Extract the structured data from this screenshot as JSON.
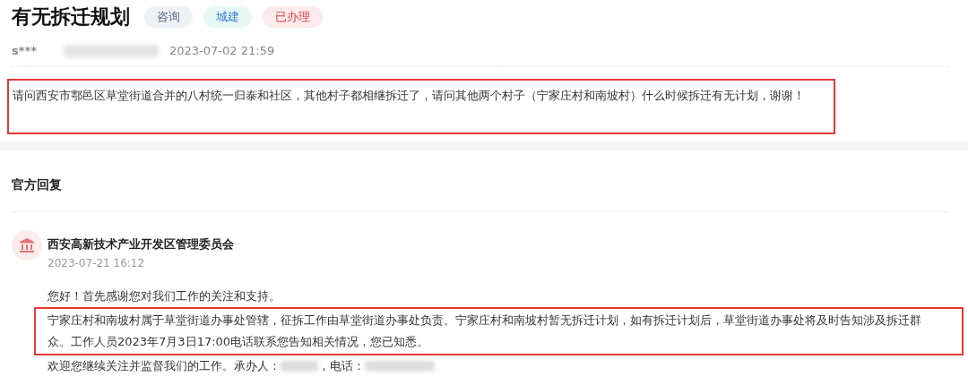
{
  "question": {
    "title": "有无拆迁规划",
    "tags": [
      {
        "label": "咨询",
        "color": "#eef2f7"
      },
      {
        "label": "城建",
        "color": "#e8f8f5"
      },
      {
        "label": "已办理",
        "color": "#fdeaea"
      }
    ],
    "author": "s***",
    "time": "2023-07-02 21:59",
    "body": "请问西安市鄠邑区草堂街道合并的八村统一归泰和社区，其他村子都相继拆迁了，请问其他两个村子（宁家庄村和南坡村）什么时候拆迁有无计划，谢谢！",
    "highlighted": true
  },
  "reply_section": {
    "heading": "官方回复",
    "reply": {
      "org": "西安高新技术产业开发区管理委员会",
      "time": "2023-07-21 16:12",
      "paragraphs": [
        {
          "text": "您好！首先感谢您对我们工作的关注和支持。",
          "highlighted": false
        },
        {
          "text": "宁家庄村和南坡村属于草堂街道办事处管辖，征拆工作由草堂街道办事处负责。宁家庄村和南坡村暂无拆迁计划，如有拆迁计划后，草堂街道办事处将及时告知涉及拆迁群众。工作人员2023年7月3日17:00电话联系您告知相关情况，您已知悉。",
          "highlighted": true
        }
      ],
      "closing": "欢迎您继续关注并监督我们的工作。承办人：",
      "phone_label": "，电话："
    }
  }
}
